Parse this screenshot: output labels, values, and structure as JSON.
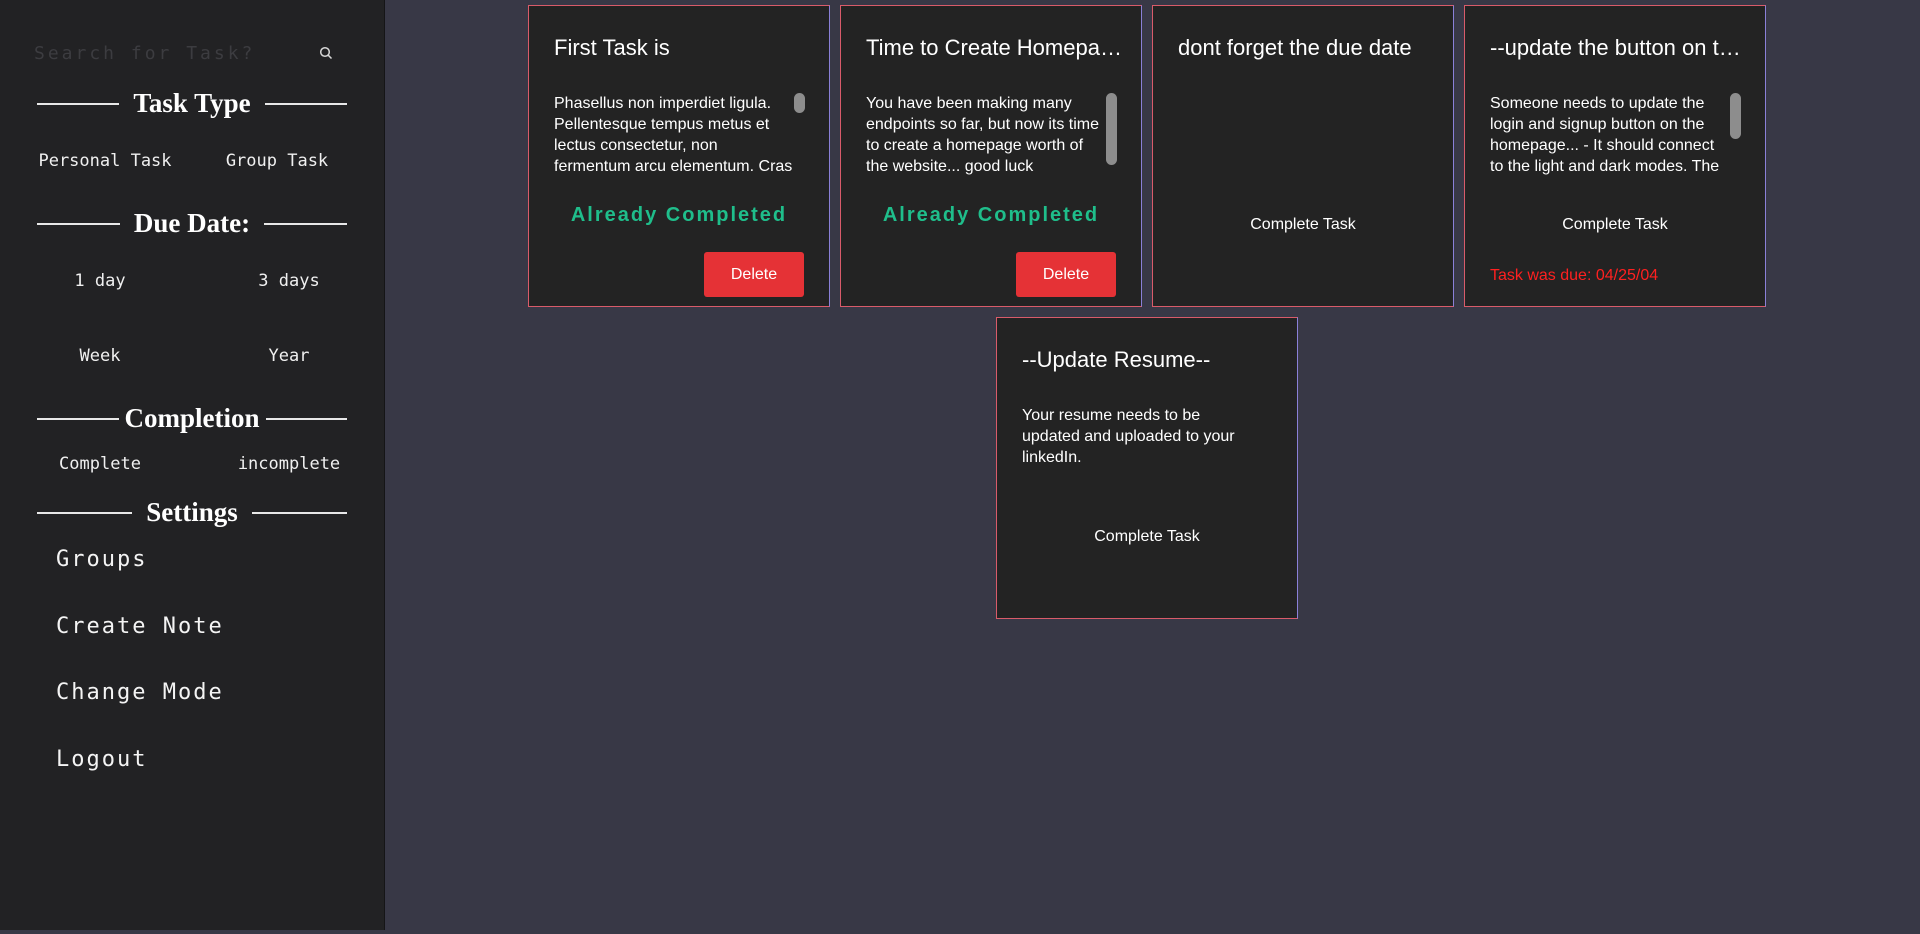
{
  "sidebar": {
    "search": {
      "placeholder": "Search for Task?",
      "value": ""
    },
    "task_type": {
      "heading": "Task Type",
      "options": [
        "Personal Task",
        "Group Task"
      ]
    },
    "due_date": {
      "heading": "Due Date:",
      "options": [
        "1 day",
        "3 days",
        "Week",
        "Year"
      ]
    },
    "completion": {
      "heading": "Completion",
      "options": [
        "Complete",
        "incomplete"
      ]
    },
    "settings": {
      "heading": "Settings",
      "items": [
        "Groups",
        "Create Note",
        "Change Mode",
        "Logout"
      ]
    }
  },
  "tasks": [
    {
      "title": "First Task is",
      "description": "Phasellus non imperdiet ligula. Pellentesque tempus metus et lectus consectetur, non fermentum arcu elementum. Cras vel sem sed...",
      "status": "Already Completed",
      "delete_label": "Delete"
    },
    {
      "title": "Time to Create Homepage",
      "description": "You have been making many endpoints so far, but now its time to create a homepage worth of the website... good luck",
      "status": "Already Completed",
      "delete_label": "Delete"
    },
    {
      "title": "dont forget the due date",
      "description": "",
      "action_label": "Complete Task"
    },
    {
      "title": "--update the button on the homepage--",
      "description": "Someone needs to update the login and signup button on the homepage... - It should connect to the light and dark modes. The project should fit...",
      "action_label": "Complete Task",
      "due_notice": "Task was due: 04/25/04"
    },
    {
      "title": "--Update Resume--",
      "description": "Your resume needs to be updated and uploaded to your linkedIn.",
      "action_label": "Complete Task"
    }
  ],
  "colors": {
    "page_bg": "#383846",
    "sidebar_bg": "#222224",
    "card_bg": "#232323",
    "completed_text": "#1fbe8b",
    "delete_button": "#e53236",
    "due_text": "#ff2020"
  }
}
